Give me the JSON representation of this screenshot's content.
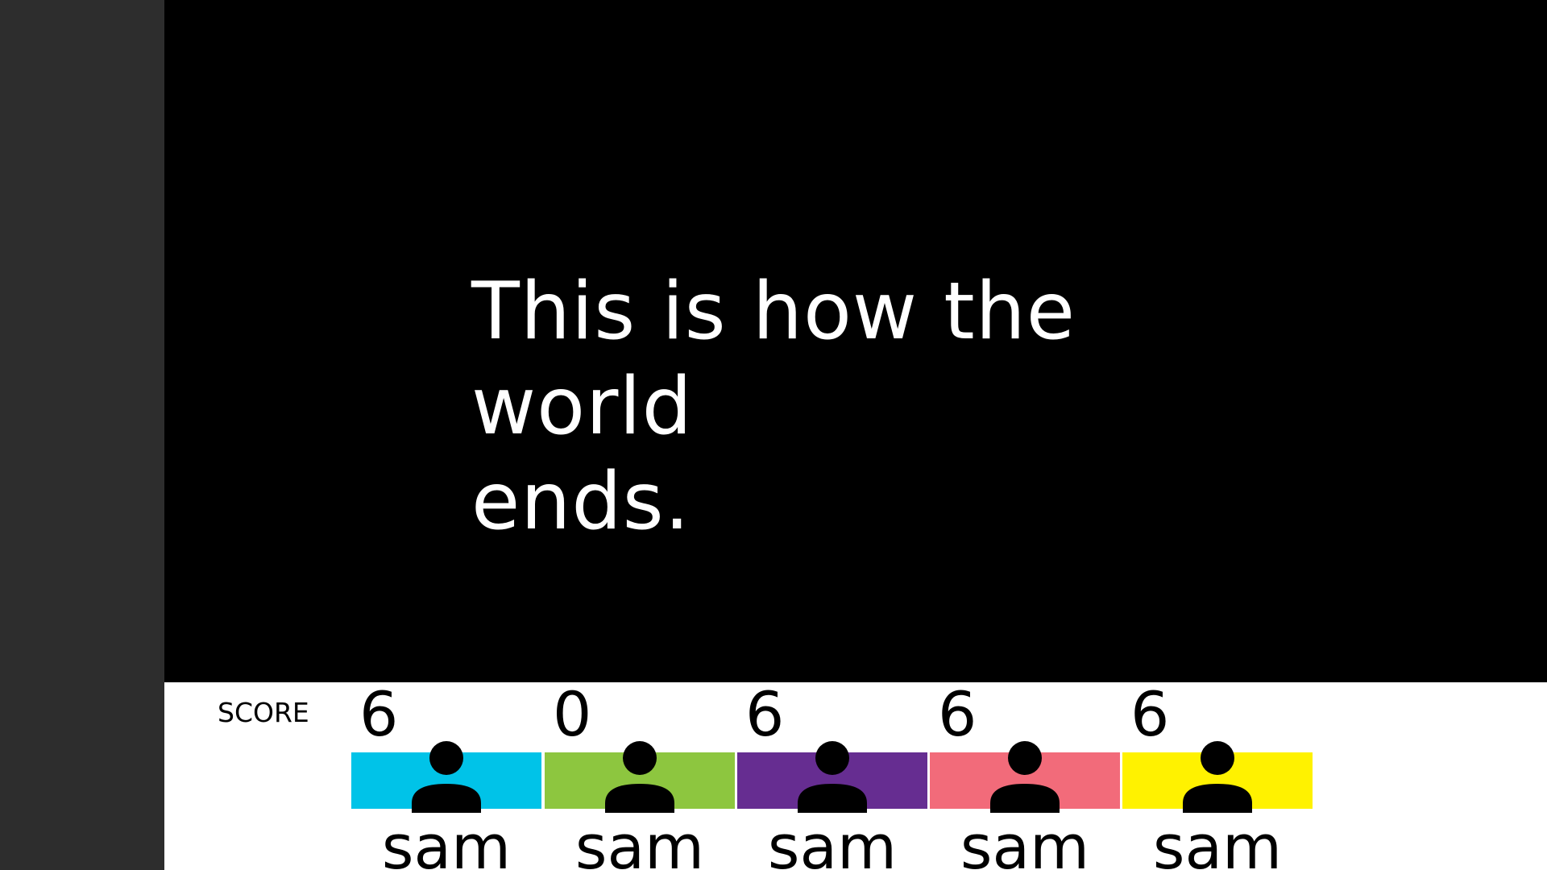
{
  "prompt": {
    "line1": "This is how the world",
    "line2": "ends."
  },
  "scoreboard": {
    "label": "SCORE",
    "players": [
      {
        "score": "6",
        "name": "sam",
        "color": "#00c3e8",
        "icon": "person-icon"
      },
      {
        "score": "0",
        "name": "sam",
        "color": "#8dc63f",
        "icon": "person-icon"
      },
      {
        "score": "6",
        "name": "sam",
        "color": "#662d91",
        "icon": "person-icon"
      },
      {
        "score": "6",
        "name": "sam",
        "color": "#f26b7a",
        "icon": "person-icon"
      },
      {
        "score": "6",
        "name": "sam",
        "color": "#fff200",
        "icon": "person-icon"
      }
    ]
  },
  "colors": {
    "stage": "#000000",
    "left_rail": "#2d2d2d",
    "scoreboard": "#ffffff"
  }
}
